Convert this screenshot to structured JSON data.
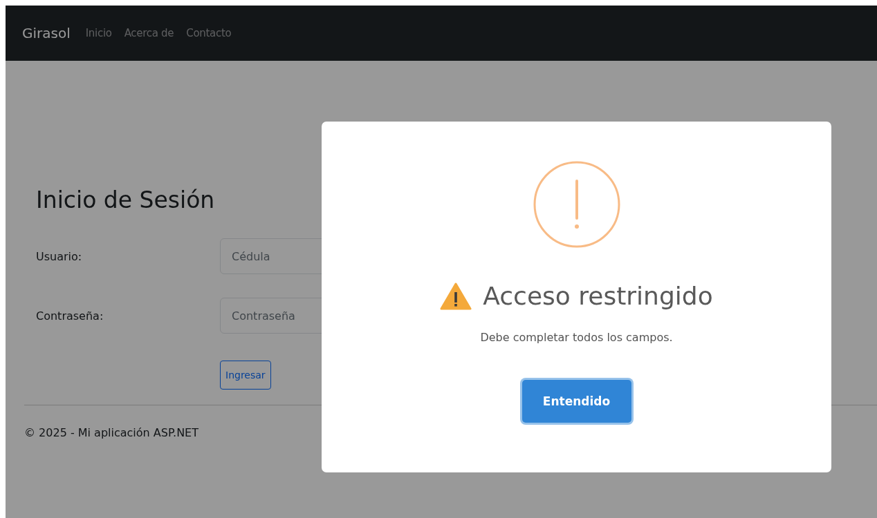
{
  "navbar": {
    "brand": "Girasol",
    "links": [
      "Inicio",
      "Acerca de",
      "Contacto"
    ]
  },
  "login": {
    "title": "Inicio de Sesión",
    "fields": [
      {
        "label": "Usuario:",
        "placeholder": "Cédula"
      },
      {
        "label": "Contraseña:",
        "placeholder": "Contraseña"
      }
    ],
    "button": "Ingresar"
  },
  "footer": "© 2025 - Mi aplicación ASP.NET",
  "modal": {
    "title": "Acceso restringido",
    "message": "Debe completar todos los campos.",
    "button": "Entendido"
  }
}
